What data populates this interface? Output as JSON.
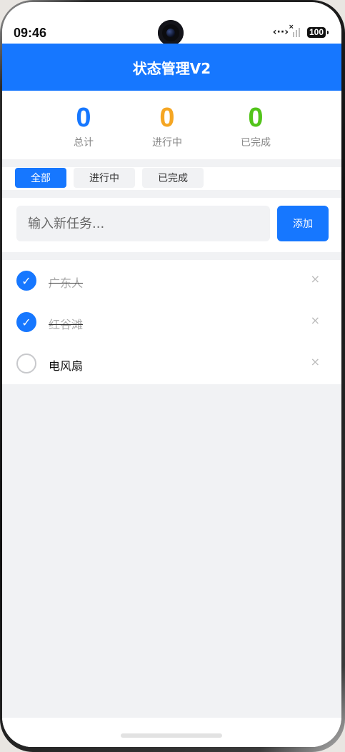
{
  "status_bar": {
    "time": "09:46",
    "battery": "100"
  },
  "header": {
    "title": "状态管理V2"
  },
  "stats": [
    {
      "value": "0",
      "label": "总计",
      "color": "#1677ff"
    },
    {
      "value": "0",
      "label": "进行中",
      "color": "#f5a623"
    },
    {
      "value": "0",
      "label": "已完成",
      "color": "#52c41a"
    }
  ],
  "tabs": [
    {
      "label": "全部",
      "active": true
    },
    {
      "label": "进行中",
      "active": false
    },
    {
      "label": "已完成",
      "active": false
    }
  ],
  "input": {
    "placeholder": "输入新任务...",
    "value": "",
    "add_label": "添加"
  },
  "tasks": [
    {
      "text": "广东人",
      "done": true
    },
    {
      "text": "红谷滩",
      "done": true
    },
    {
      "text": "电风扇",
      "done": false
    }
  ],
  "colors": {
    "accent": "#1677ff",
    "background": "#f1f2f4"
  }
}
